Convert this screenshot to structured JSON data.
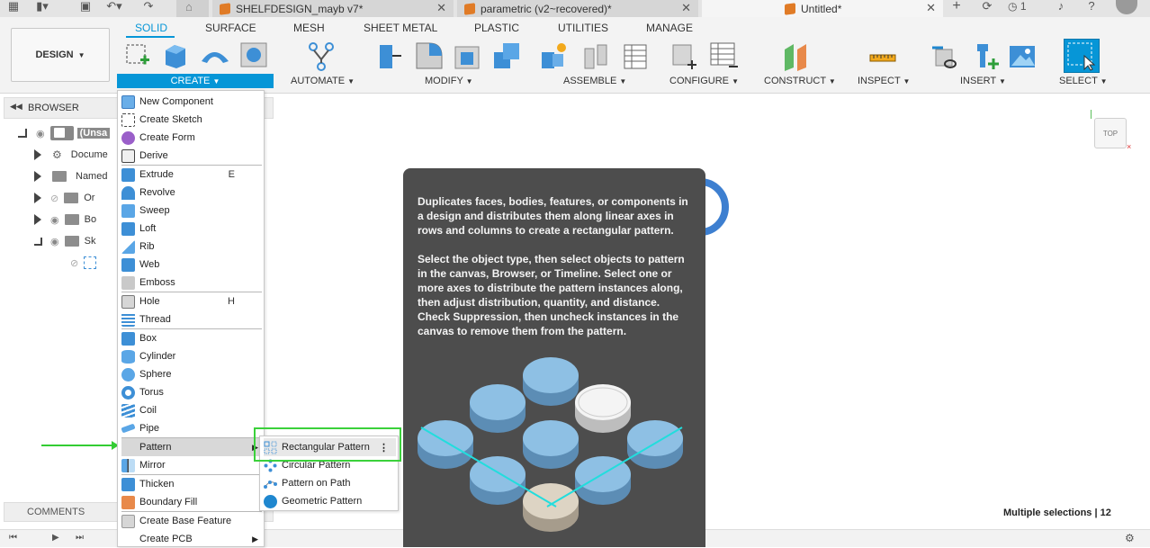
{
  "titlebar": {
    "tabs": [
      {
        "label": "SHELFDESIGN_mayb v7*"
      },
      {
        "label": "parametric (v2~recovered)*"
      },
      {
        "label": "Untitled*"
      }
    ],
    "notification_count": "1"
  },
  "toolbar": {
    "workspace_label": "DESIGN",
    "tabs": [
      "SOLID",
      "SURFACE",
      "MESH",
      "SHEET METAL",
      "PLASTIC",
      "UTILITIES",
      "MANAGE"
    ],
    "active_tab": "SOLID",
    "groups": [
      "CREATE",
      "AUTOMATE",
      "MODIFY",
      "ASSEMBLE",
      "CONFIGURE",
      "CONSTRUCT",
      "INSPECT",
      "INSERT",
      "SELECT"
    ],
    "accent_color": "#0696d7"
  },
  "browser": {
    "title": "BROWSER",
    "items": [
      {
        "label": "(Unsa"
      },
      {
        "label": "Docume"
      },
      {
        "label": "Named"
      },
      {
        "label": "Or"
      },
      {
        "label": "Bo"
      },
      {
        "label": "Sk"
      }
    ]
  },
  "create_menu": {
    "items": [
      {
        "label": "New Component",
        "shortcut": ""
      },
      {
        "label": "Create Sketch",
        "shortcut": ""
      },
      {
        "label": "Create Form",
        "shortcut": ""
      },
      {
        "label": "Derive",
        "shortcut": ""
      },
      {
        "label": "Extrude",
        "shortcut": "E"
      },
      {
        "label": "Revolve",
        "shortcut": ""
      },
      {
        "label": "Sweep",
        "shortcut": ""
      },
      {
        "label": "Loft",
        "shortcut": ""
      },
      {
        "label": "Rib",
        "shortcut": ""
      },
      {
        "label": "Web",
        "shortcut": ""
      },
      {
        "label": "Emboss",
        "shortcut": ""
      },
      {
        "label": "Hole",
        "shortcut": "H"
      },
      {
        "label": "Thread",
        "shortcut": ""
      },
      {
        "label": "Box",
        "shortcut": ""
      },
      {
        "label": "Cylinder",
        "shortcut": ""
      },
      {
        "label": "Sphere",
        "shortcut": ""
      },
      {
        "label": "Torus",
        "shortcut": ""
      },
      {
        "label": "Coil",
        "shortcut": ""
      },
      {
        "label": "Pipe",
        "shortcut": ""
      },
      {
        "label": "Pattern",
        "shortcut": ""
      },
      {
        "label": "Mirror",
        "shortcut": ""
      },
      {
        "label": "Thicken",
        "shortcut": ""
      },
      {
        "label": "Boundary Fill",
        "shortcut": ""
      },
      {
        "label": "Create Base Feature",
        "shortcut": ""
      },
      {
        "label": "Create PCB",
        "shortcut": ""
      }
    ]
  },
  "pattern_submenu": {
    "items": [
      {
        "label": "Rectangular Pattern"
      },
      {
        "label": "Circular Pattern"
      },
      {
        "label": "Pattern on Path"
      },
      {
        "label": "Geometric Pattern"
      }
    ]
  },
  "tooltip": {
    "paragraph1": "Duplicates faces, bodies, features, or components in a design and distributes them along linear axes in rows and columns to create a rectangular pattern.",
    "paragraph2": "Select the object type, then select objects to pattern in the canvas, Browser, or Timeline. Select one or more axes to distribute the pattern instances along, then adjust distribution, quantity, and distance. Check Suppression, then uncheck instances in the canvas to remove them from the pattern."
  },
  "canvas": {
    "viewcube_label": "TOP",
    "status": "Multiple selections | 12"
  },
  "comments": {
    "label": "COMMENTS"
  }
}
